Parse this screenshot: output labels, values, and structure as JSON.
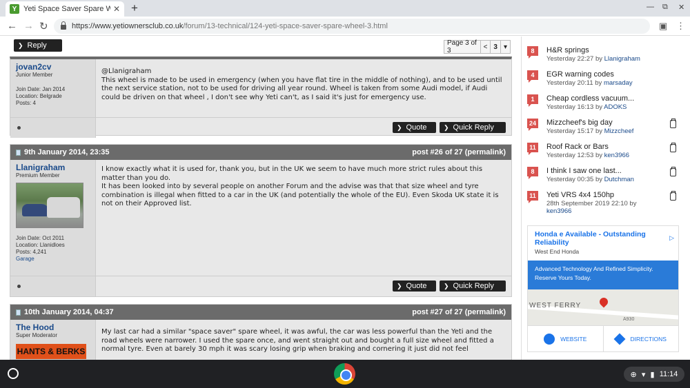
{
  "browser": {
    "tab_title": "Yeti Space Saver Spare Wheel. - P",
    "favicon_letter": "Y",
    "url_host": "https://www.yetiownersclub.co.uk",
    "url_path": "/forum/13-technical/124-yeti-space-saver-spare-wheel-3.html"
  },
  "toolbar": {
    "reply_label": "Reply",
    "page_info": "Page 3 of 3",
    "prev_symbol": "<",
    "current_page": "3",
    "dropdown_symbol": "▾"
  },
  "posts": [
    {
      "author": "jovan2cv",
      "rank": "Junior Member",
      "join_date": "Join Date: Jan 2014",
      "location": "Location: Belgrade",
      "posts": "Posts: 4",
      "message": "@Llanigraham\nThis wheel is made to be used in emergency (when you have flat tire in the middle of nothing), and to be used until the next service station, not to be used for driving all year round. Wheel is taken from some Audi model, if Audi could be driven on that wheel , I don't see why Yeti can't, as I said it's just for emergency use.",
      "quote_label": "Quote",
      "quick_reply_label": "Quick Reply"
    },
    {
      "date": "9th January 2014, 23:35",
      "post_num": "post #26 of 27 (permalink)",
      "author": "Llanigraham",
      "rank": "Premium Member",
      "join_date": "Join Date: Oct 2011",
      "location": "Location: Llanidloes",
      "posts": "Posts: 4,241",
      "garage": "Garage",
      "message": "I know exactly what it is used for, thank you, but in the UK we seem to have much more strict rules about this matter than you do.\nIt has been looked into by several people on another Forum and the advise was that that size wheel and tyre combination is illegal when fitted to a car in the UK (and potentially the whole of the EU). Even Skoda UK state it is not on their Approved list.",
      "quote_label": "Quote",
      "quick_reply_label": "Quick Reply"
    },
    {
      "date": "10th January 2014, 04:37",
      "post_num": "post #27 of 27 (permalink)",
      "author": "The Hood",
      "rank": "Super Moderator",
      "badge": "HANTS & BERKS",
      "message": "My last car had a similar \"space saver\" spare wheel, it was awful, the car was less powerful than the Yeti and the road wheels were narrower. I used the spare once, and went straight out and bought a full size wheel and fitted a normal tyre. Even at barely 30 mph it was scary losing grip when braking and cornering it just did not feel"
    }
  ],
  "sidebar": {
    "items": [
      {
        "count": "8",
        "title": "H&R springs",
        "time": "Yesterday 22:27 by",
        "by": "Llanigraham",
        "clip": false
      },
      {
        "count": "4",
        "title": "EGR warning codes",
        "time": "Yesterday 20:11 by",
        "by": "marsaday",
        "clip": false
      },
      {
        "count": "1",
        "title": "Cheap cordless vacuum...",
        "time": "Yesterday 16:13 by",
        "by": "ADOKS",
        "clip": false
      },
      {
        "count": "24",
        "title": "Mizzcheef's big day",
        "time": "Yesterday 15:17 by",
        "by": "Mizzcheef",
        "clip": true
      },
      {
        "count": "11",
        "title": "Roof Rack or Bars",
        "time": "Yesterday 12:53 by",
        "by": "ken3966",
        "clip": true
      },
      {
        "count": "8",
        "title": "I think I saw one last...",
        "time": "Yesterday 00:35 by",
        "by": "Dutchman",
        "clip": true
      },
      {
        "count": "11",
        "title": "Yeti VRS 4x4 150hp",
        "time": "28th September 2019 22:10 by",
        "by": "ken3966",
        "clip": true
      }
    ]
  },
  "ad": {
    "title": "Honda e Available - Outstanding Reliability",
    "advertiser": "West End Honda",
    "body": "Advanced Technology And Refined Simplicity. Reserve Yours Today.",
    "map_label": "WEST FERRY",
    "map_road": "A930",
    "website_label": "WEBSITE",
    "directions_label": "DIRECTIONS"
  },
  "shelf": {
    "time": "11:14"
  },
  "colors": {
    "post_header": "#6b6b6b",
    "count_badge": "#d9534f",
    "link": "#1a4a8a",
    "ad_blue": "#2a7bd8"
  }
}
